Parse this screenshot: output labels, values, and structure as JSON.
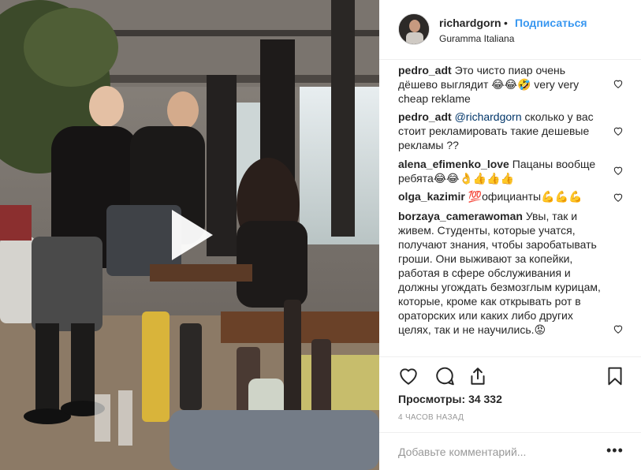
{
  "post": {
    "username": "richardgorn",
    "dot": "•",
    "follow_label": "Подписаться",
    "location": "Guramma Italiana"
  },
  "comments": [
    {
      "user": "pedro_adt",
      "text": "Это чисто пиар очень дёшево выглядит 😂😂🤣 very very cheap reklame"
    },
    {
      "user": "pedro_adt",
      "mention": "@richardgorn",
      "text": "сколько у вас стоит рекламировать такие дешевые рекламы ??"
    },
    {
      "user": "alena_efimenko_love",
      "text": "Пацаны вообще ребята😂😂👌👍👍👍"
    },
    {
      "user": "olga_kazimir",
      "text": "💯официанты💪💪💪"
    },
    {
      "user": "borzaya_camerawoman",
      "text": "Увы, так и живем. Студенты, которые учатся, получают знания, чтобы заробатывать гроши. Они выживают за копейки, работая в сфере обслуживания и должны угождать безмозглым курицам, которые, кроме как открывать рот в ораторских или каких либо других целях, так и не научились.😡"
    }
  ],
  "views": {
    "label": "Просмотры:",
    "count": "34 332"
  },
  "timestamp": "4 ЧАСОВ НАЗАД",
  "comment_input": {
    "placeholder": "Добавьте комментарий...",
    "value": ""
  },
  "more_label": "•••",
  "icons": {
    "like": "heart-icon",
    "comment": "speech-bubble-icon",
    "share": "share-icon",
    "save": "bookmark-icon",
    "play": "play-icon",
    "comment_like": "small-heart-icon"
  },
  "colors": {
    "link": "#3897f0",
    "mention": "#003569",
    "text": "#262626",
    "muted": "#999999",
    "divider": "#efefef"
  }
}
